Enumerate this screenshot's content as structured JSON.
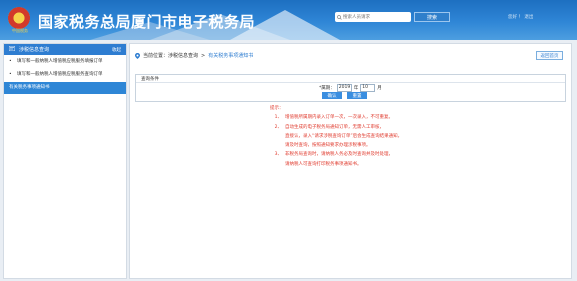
{
  "header": {
    "emblem_caption": "中国税务",
    "title": "国家税务总局厦门市电子税务局",
    "search_placeholder": "搜索人员请求",
    "search_button": "搜索",
    "user_links": "您好 ！ 退出"
  },
  "sidebar": {
    "title": "涉税信息查询",
    "collapse_label": "收起",
    "items": [
      {
        "label": "填写和一般纳税人增值税应税服务填报订单",
        "active": false
      },
      {
        "label": "填写和一般纳税人增值税应税服务查询订单",
        "active": false
      },
      {
        "label": "有关税务事项通知书",
        "active": true
      }
    ]
  },
  "breadcrumb": {
    "prefix": "当前位置：",
    "parent": "涉税信息查询",
    "separator": ">",
    "current": "有关税务事项通知书"
  },
  "return_button": "返回首页",
  "query": {
    "legend": "查询条件",
    "date_label": "*属期：",
    "year_value": "2019",
    "year_unit": "年",
    "month_value": "10",
    "month_unit": "月",
    "confirm_button": "确认",
    "reset_button": "重置"
  },
  "tips": {
    "title": "提示：",
    "lines": [
      {
        "num": "1、",
        "text": "增值税所属期内录入订单一次，一次录入，不可重复。"
      },
      {
        "num": "2、",
        "text": "自动生成的电子税务局通知订单，无需人工审核，"
      },
      {
        "num": "",
        "text": "直接认，录入“请求涉税查询订单”后会生成查询结果通知，"
      },
      {
        "num": "",
        "text": "请及时查询，按照通知要求办理涉税事项。"
      },
      {
        "num": "3、",
        "text": "非税务局查询时，请纳税人务必及时查询并及时处理，"
      },
      {
        "num": "",
        "text": "请纳税人可查询打印税务事项通知书。"
      }
    ]
  },
  "colors": {
    "header_blue": "#2f86d6",
    "accent": "#2e7dd1",
    "tip_red": "#e03c2f"
  }
}
